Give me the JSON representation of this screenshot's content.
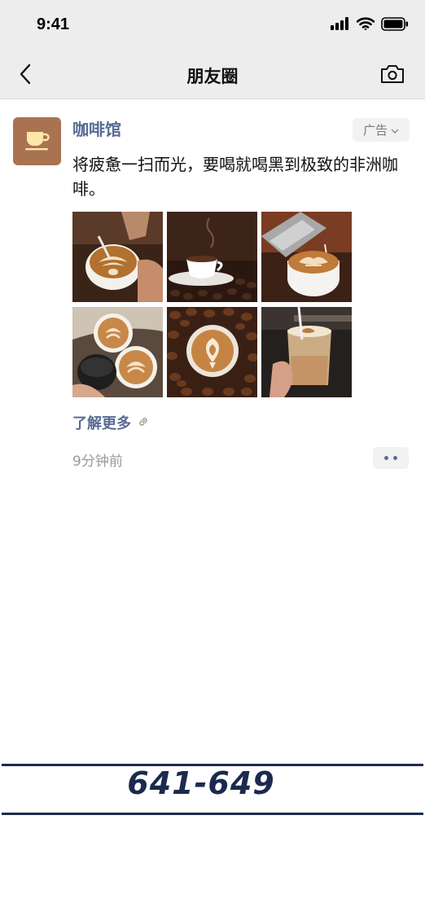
{
  "status_bar": {
    "time": "9:41",
    "icons": [
      "signal-icon",
      "wifi-icon",
      "battery-icon"
    ]
  },
  "nav": {
    "title": "朋友圈",
    "back_icon": "chevron-left-icon",
    "camera_icon": "camera-icon"
  },
  "post": {
    "author": "咖啡馆",
    "avatar_icon": "coffee-cup-icon",
    "ad_label": "广告",
    "text": "将疲惫一扫而光，要喝就喝黑到极致的非洲咖啡。",
    "images": [
      "latte-art-pour",
      "white-cup-on-beans",
      "milk-pitcher-pour",
      "two-latte-cups",
      "latte-on-beans",
      "iced-latte-glass"
    ],
    "link_label": "了解更多",
    "link_icon": "link-icon",
    "time": "9分钟前",
    "more_icon": "more-dots-icon"
  },
  "footer": {
    "range": "641-649"
  },
  "colors": {
    "nav_bg": "#ededed",
    "link_blue": "#576b95",
    "footer_navy": "#1b2a4e",
    "avatar_brown": "#a97352"
  }
}
